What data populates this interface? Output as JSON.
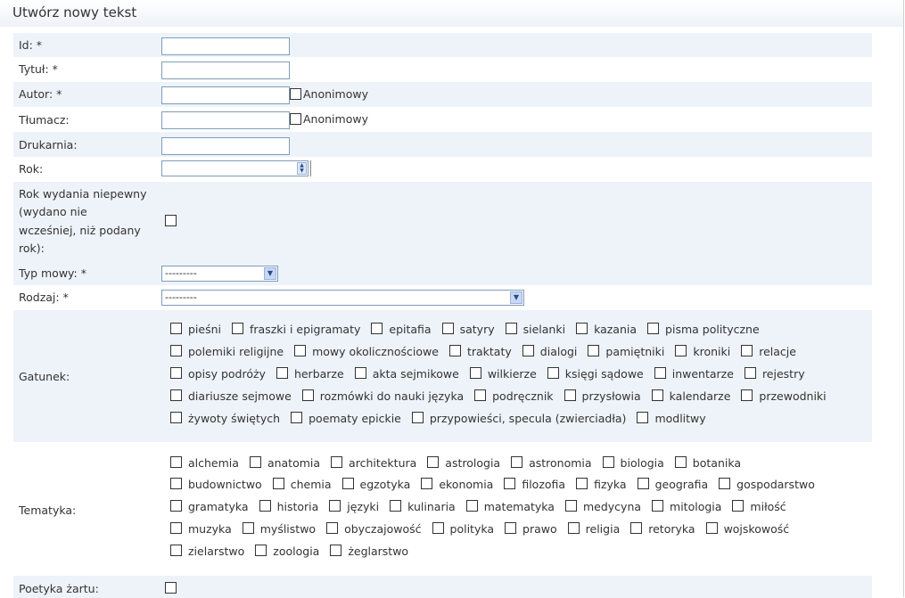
{
  "page": {
    "title": "Utwórz nowy tekst"
  },
  "fields": {
    "id": {
      "label": "Id: *",
      "value": ""
    },
    "tytul": {
      "label": "Tytuł: *",
      "value": ""
    },
    "autor": {
      "label": "Autor: *",
      "value": "",
      "anon_label": "Anonimowy",
      "anon_checked": false
    },
    "tlumacz": {
      "label": "Tłumacz:",
      "value": "",
      "anon_label": "Anonimowy",
      "anon_checked": false
    },
    "drukarnia": {
      "label": "Drukarnia:",
      "value": ""
    },
    "rok": {
      "label": "Rok:",
      "value": ""
    },
    "rok_niepewny": {
      "label": [
        "Rok wydania niepewny",
        "(wydano nie",
        "wcześniej, niż podany",
        "rok):"
      ],
      "checked": false
    },
    "typ_mowy": {
      "label": "Typ mowy: *",
      "selected": "---------"
    },
    "rodzaj": {
      "label": "Rodzaj: *",
      "selected": "---------"
    },
    "gatunek": {
      "label": "Gatunek:",
      "rows": [
        [
          "pieśni",
          "fraszki i epigramaty",
          "epitafia",
          "satyry",
          "sielanki",
          "kazania",
          "pisma polityczne"
        ],
        [
          "polemiki religijne",
          "mowy okolicznościowe",
          "traktaty",
          "dialogi",
          "pamiętniki",
          "kroniki",
          "relacje"
        ],
        [
          "opisy podróży",
          "herbarze",
          "akta sejmikowe",
          "wilkierze",
          "księgi sądowe",
          "inwentarze",
          "rejestry"
        ],
        [
          "diariusze sejmowe",
          "rozmówki do nauki języka",
          "podręcznik",
          "przysłowia",
          "kalendarze",
          "przewodniki"
        ],
        [
          "żywoty świętych",
          "poematy epickie",
          "przypowieści, specula (zwierciadła)",
          "modlitwy"
        ]
      ]
    },
    "tematyka": {
      "label": "Tematyka:",
      "rows": [
        [
          "alchemia",
          "anatomia",
          "architektura",
          "astrologia",
          "astronomia",
          "biologia",
          "botanika"
        ],
        [
          "budownictwo",
          "chemia",
          "egzotyka",
          "ekonomia",
          "filozofia",
          "fizyka",
          "geografia",
          "gospodarstwo"
        ],
        [
          "gramatyka",
          "historia",
          "języki",
          "kulinaria",
          "matematyka",
          "medycyna",
          "mitologia",
          "miłość"
        ],
        [
          "muzyka",
          "myślistwo",
          "obyczajowość",
          "polityka",
          "prawo",
          "religia",
          "retoryka",
          "wojskowość"
        ],
        [
          "zielarstwo",
          "zoologia",
          "żeglarstwo"
        ]
      ]
    },
    "poetyka_zartu": {
      "label": "Poetyka żartu:",
      "checked": false
    }
  },
  "colors": {
    "row_shade": "#eef3f9",
    "input_border": "#7f9db9"
  },
  "icons": {
    "select_arrow": "chevron-down-icon",
    "spinner": "spinner-icon"
  }
}
